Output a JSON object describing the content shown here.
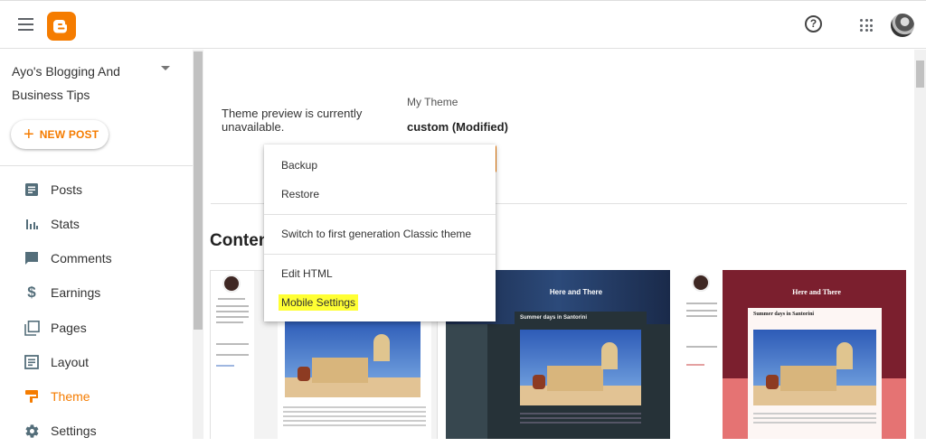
{
  "header": {
    "menu_icon": "hamburger-menu-icon",
    "logo_icon": "blogger-logo-icon",
    "help_icon": "help-circle-icon",
    "apps_icon": "apps-grid-icon",
    "avatar_icon": "user-avatar"
  },
  "sidebar": {
    "blog_title": "Ayo's Blogging And Business Tips",
    "new_post_label": "NEW POST",
    "items": [
      {
        "label": "Posts",
        "icon": "posts-icon"
      },
      {
        "label": "Stats",
        "icon": "stats-icon"
      },
      {
        "label": "Comments",
        "icon": "comments-icon"
      },
      {
        "label": "Earnings",
        "icon": "dollar-icon"
      },
      {
        "label": "Pages",
        "icon": "pages-icon"
      },
      {
        "label": "Layout",
        "icon": "layout-icon"
      },
      {
        "label": "Theme",
        "icon": "theme-icon",
        "active": true
      },
      {
        "label": "Settings",
        "icon": "gear-icon"
      }
    ]
  },
  "main": {
    "preview_message": "Theme preview is currently unavailable.",
    "my_theme_label": "My Theme",
    "my_theme_name": "custom (Modified)",
    "contents_title": "Conten",
    "cards": [
      {
        "title": ""
      },
      {
        "title": "Here and There",
        "post_title": "Summer days in Santorini"
      },
      {
        "title": "Here and There",
        "post_title": "Summer days in Santorini"
      }
    ]
  },
  "menu": {
    "items": [
      "Backup",
      "Restore",
      "Switch to first generation Classic theme",
      "Edit HTML",
      "Mobile Settings"
    ]
  },
  "colors": {
    "accent": "#f57c00",
    "highlight": "#ffff33"
  }
}
